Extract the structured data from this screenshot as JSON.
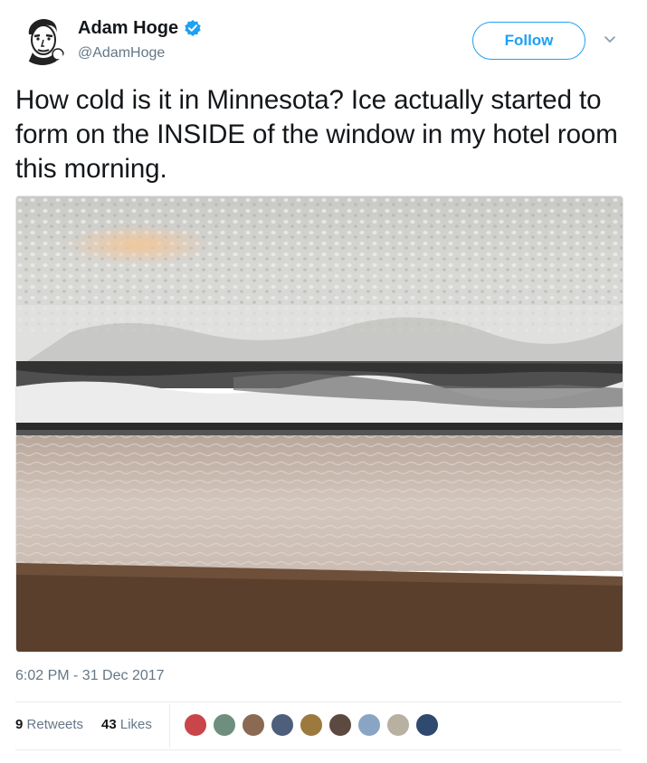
{
  "author": {
    "display_name": "Adam Hoge",
    "handle": "@AdamHoge",
    "verified": true
  },
  "follow_button": {
    "label": "Follow"
  },
  "tweet": {
    "text": "How cold is it in Minnesota? Ice actually started to form on the INSIDE of the window in my hotel room this morning.",
    "timestamp": "6:02 PM - 31 Dec 2017"
  },
  "stats": {
    "retweets_count": "9",
    "retweets_label": "Retweets",
    "likes_count": "43",
    "likes_label": "Likes"
  },
  "likers": [
    {
      "icon": "liker-avatar"
    },
    {
      "icon": "liker-avatar"
    },
    {
      "icon": "liker-avatar"
    },
    {
      "icon": "liker-avatar"
    },
    {
      "icon": "liker-avatar"
    },
    {
      "icon": "liker-avatar"
    },
    {
      "icon": "liker-avatar"
    },
    {
      "icon": "liker-avatar"
    },
    {
      "icon": "liker-avatar"
    }
  ],
  "colors": {
    "accent": "#1da1f2",
    "text": "#14171a",
    "muted": "#657786"
  }
}
